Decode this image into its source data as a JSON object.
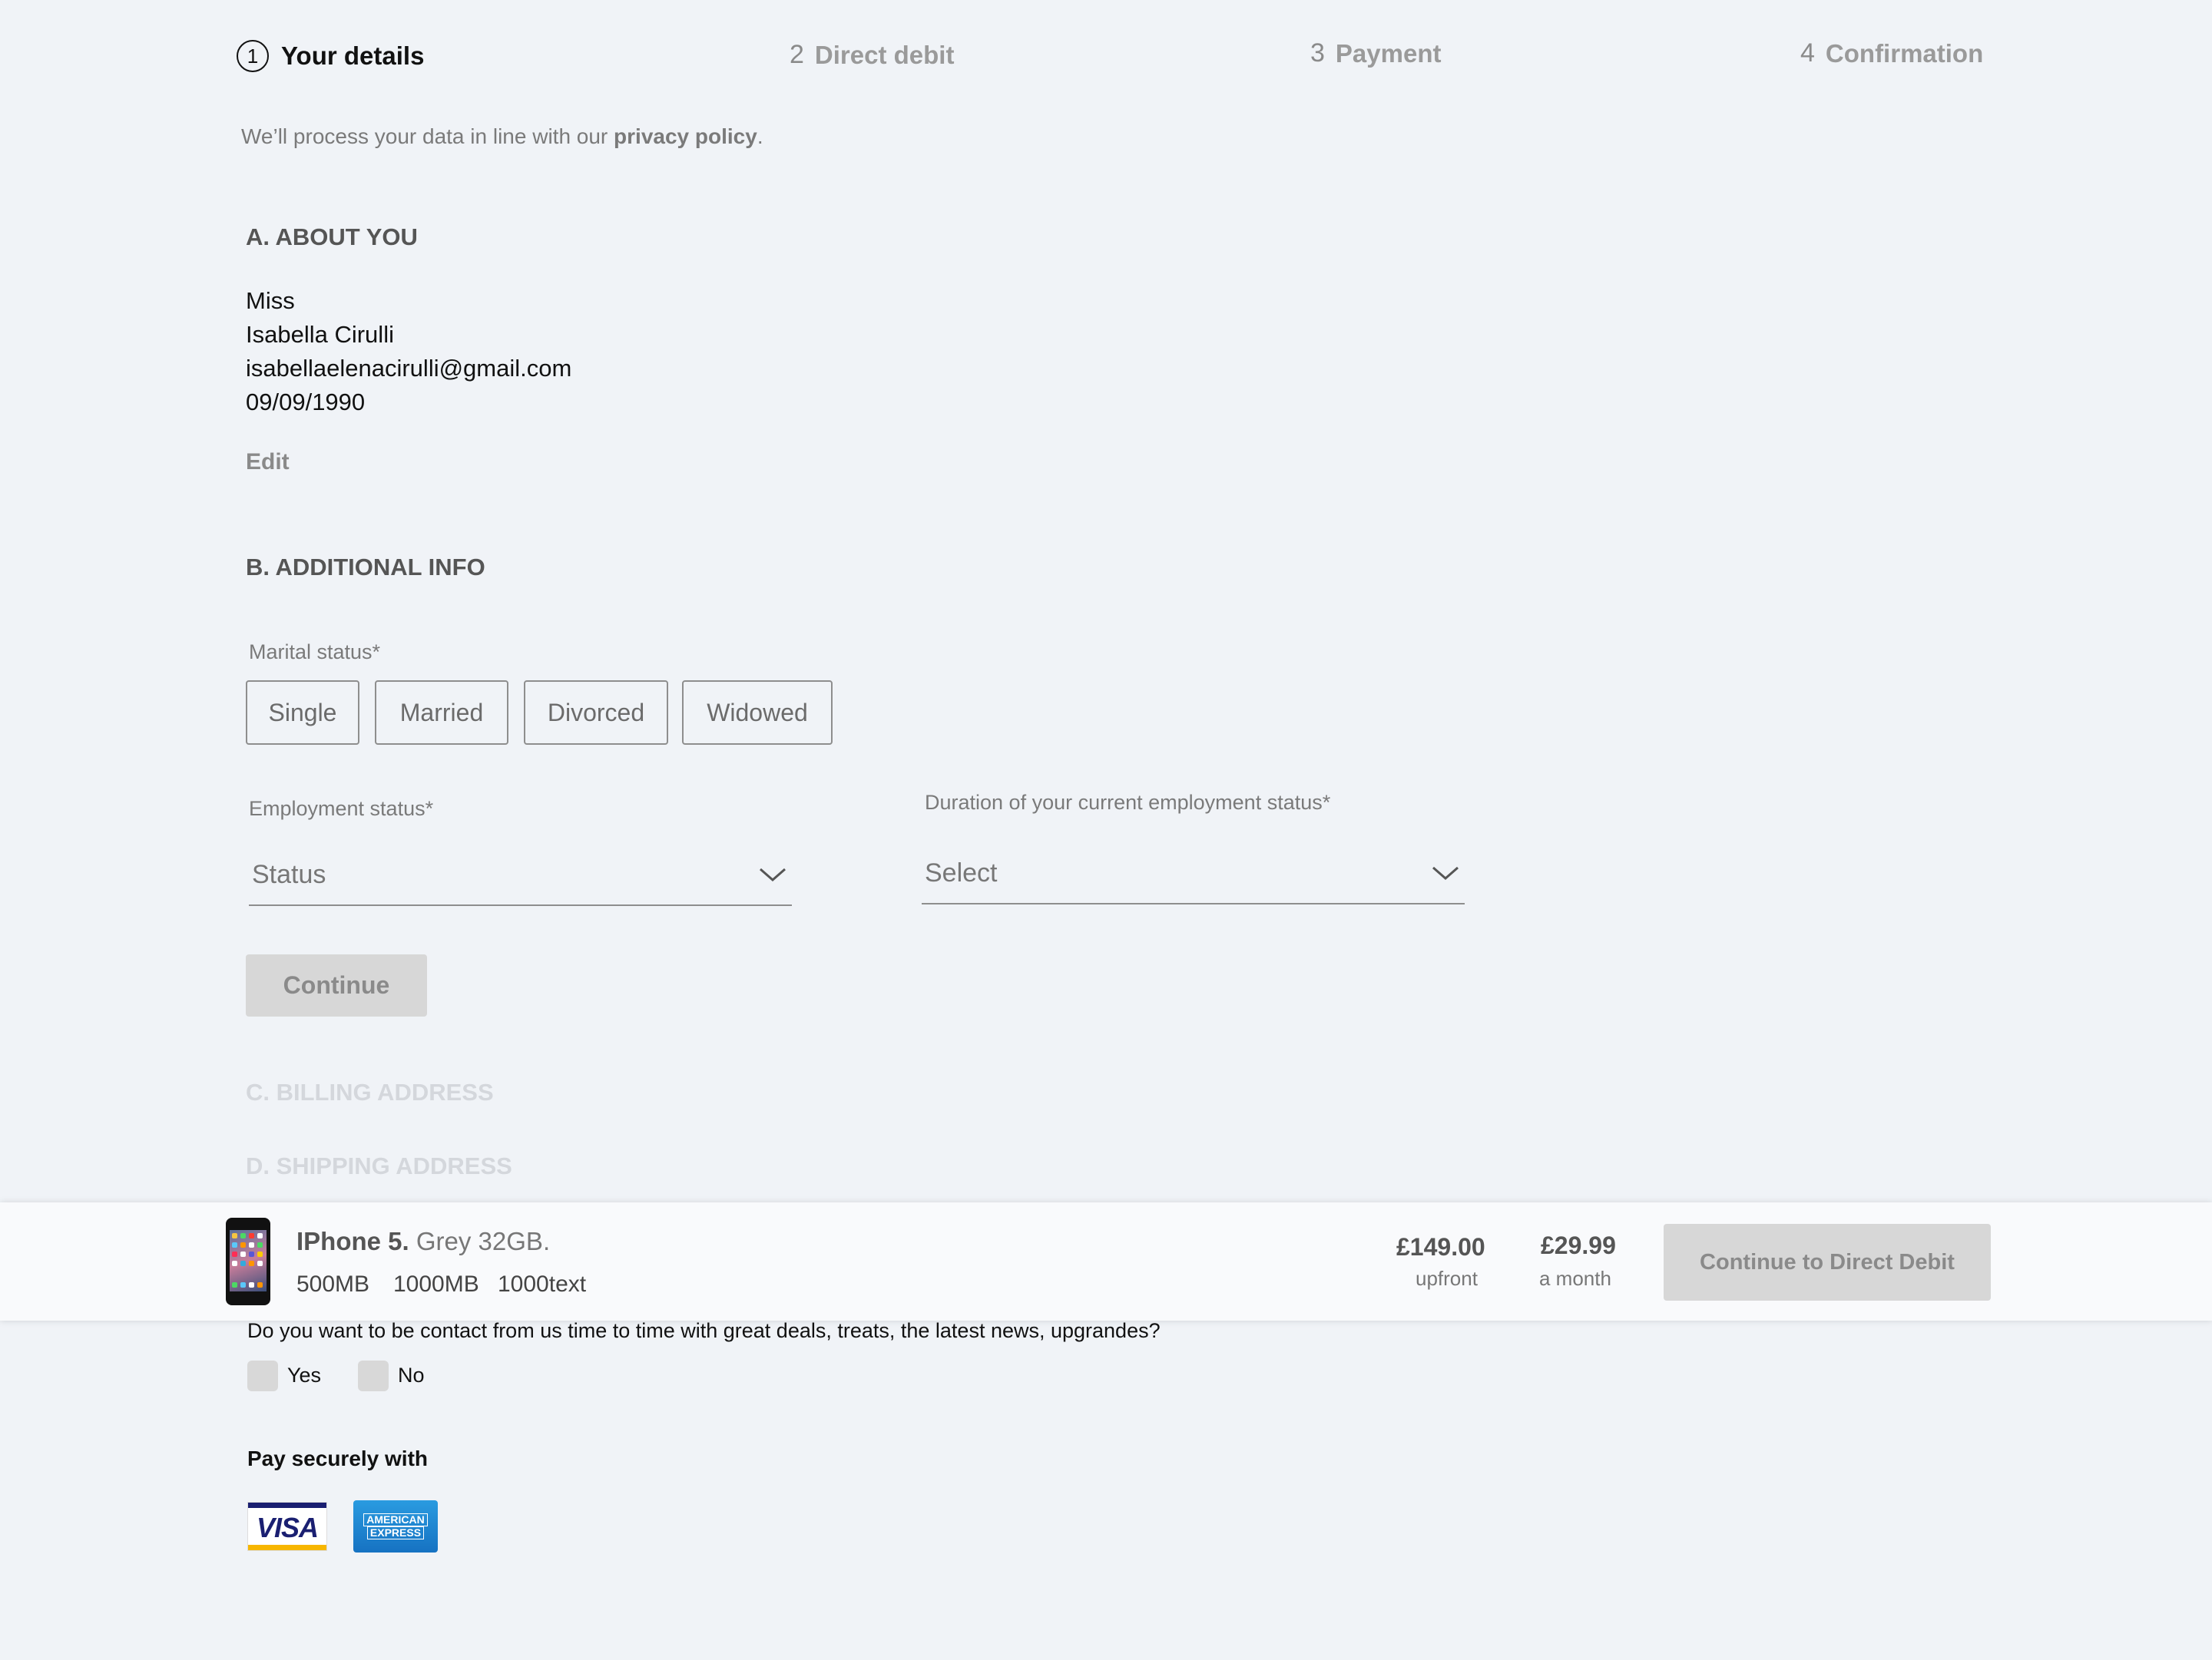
{
  "stepper": {
    "steps": [
      {
        "number": "1",
        "label": "Your details"
      },
      {
        "number": "2",
        "label": "Direct debit"
      },
      {
        "number": "3",
        "label": "Payment"
      },
      {
        "number": "4",
        "label": "Confirmation"
      }
    ]
  },
  "privacy": {
    "prefix": "We’ll process your data in line with our ",
    "link": "privacy policy",
    "suffix": "."
  },
  "about": {
    "title": "A. ABOUT YOU",
    "lines": [
      "Miss",
      "Isabella Cirulli",
      "isabellaelenacirulli@gmail.com",
      "09/09/1990"
    ],
    "edit_label": "Edit"
  },
  "additional": {
    "title": "B. ADDITIONAL INFO",
    "marital_label": "Marital status*",
    "marital_options": [
      "Single",
      "Married",
      "Divorced",
      "Widowed"
    ],
    "employment_label": "Employment status*",
    "employment_placeholder": "Status",
    "duration_label": "Duration of your current employment status*",
    "duration_placeholder": "Select",
    "continue_label": "Continue"
  },
  "billing": {
    "title": "C. BILLING ADDRESS"
  },
  "shipping": {
    "title": "D. SHIPPING ADDRESS"
  },
  "basket": {
    "product_name": "IPhone 5.",
    "product_variant": "Grey 32GB.",
    "allowances": [
      "500MB",
      "1000MB",
      "1000text"
    ],
    "upfront_price": "£149.00",
    "upfront_label": "upfront",
    "monthly_price": "£29.99",
    "monthly_label": "a month",
    "cta_label": "Continue to Direct Debit"
  },
  "marketing": {
    "question": "Do you want to be contact from us time to time with great deals, treats, the latest news, upgrandes?",
    "yes_label": "Yes",
    "no_label": "No"
  },
  "payment": {
    "title": "Pay securely with",
    "visa_text": "VISA",
    "amex_line1": "AMERICAN",
    "amex_line2": "EXPRESS"
  },
  "colors": {
    "background": "#f0f3f7",
    "disabled_button": "#d7d7d7",
    "visa_blue": "#1a1f71",
    "visa_gold": "#f7b600",
    "amex_blue": "#1672c2"
  }
}
